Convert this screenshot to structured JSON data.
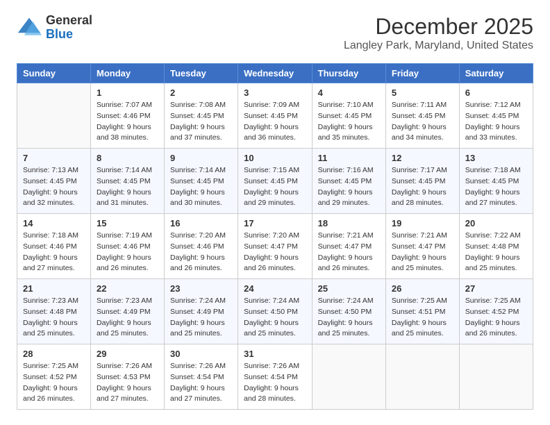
{
  "header": {
    "logo_general": "General",
    "logo_blue": "Blue",
    "month_title": "December 2025",
    "location": "Langley Park, Maryland, United States"
  },
  "weekdays": [
    "Sunday",
    "Monday",
    "Tuesday",
    "Wednesday",
    "Thursday",
    "Friday",
    "Saturday"
  ],
  "weeks": [
    [
      {
        "day": "",
        "sunrise": "",
        "sunset": "",
        "daylight": ""
      },
      {
        "day": "1",
        "sunrise": "Sunrise: 7:07 AM",
        "sunset": "Sunset: 4:46 PM",
        "daylight": "Daylight: 9 hours and 38 minutes."
      },
      {
        "day": "2",
        "sunrise": "Sunrise: 7:08 AM",
        "sunset": "Sunset: 4:45 PM",
        "daylight": "Daylight: 9 hours and 37 minutes."
      },
      {
        "day": "3",
        "sunrise": "Sunrise: 7:09 AM",
        "sunset": "Sunset: 4:45 PM",
        "daylight": "Daylight: 9 hours and 36 minutes."
      },
      {
        "day": "4",
        "sunrise": "Sunrise: 7:10 AM",
        "sunset": "Sunset: 4:45 PM",
        "daylight": "Daylight: 9 hours and 35 minutes."
      },
      {
        "day": "5",
        "sunrise": "Sunrise: 7:11 AM",
        "sunset": "Sunset: 4:45 PM",
        "daylight": "Daylight: 9 hours and 34 minutes."
      },
      {
        "day": "6",
        "sunrise": "Sunrise: 7:12 AM",
        "sunset": "Sunset: 4:45 PM",
        "daylight": "Daylight: 9 hours and 33 minutes."
      }
    ],
    [
      {
        "day": "7",
        "sunrise": "Sunrise: 7:13 AM",
        "sunset": "Sunset: 4:45 PM",
        "daylight": "Daylight: 9 hours and 32 minutes."
      },
      {
        "day": "8",
        "sunrise": "Sunrise: 7:14 AM",
        "sunset": "Sunset: 4:45 PM",
        "daylight": "Daylight: 9 hours and 31 minutes."
      },
      {
        "day": "9",
        "sunrise": "Sunrise: 7:14 AM",
        "sunset": "Sunset: 4:45 PM",
        "daylight": "Daylight: 9 hours and 30 minutes."
      },
      {
        "day": "10",
        "sunrise": "Sunrise: 7:15 AM",
        "sunset": "Sunset: 4:45 PM",
        "daylight": "Daylight: 9 hours and 29 minutes."
      },
      {
        "day": "11",
        "sunrise": "Sunrise: 7:16 AM",
        "sunset": "Sunset: 4:45 PM",
        "daylight": "Daylight: 9 hours and 29 minutes."
      },
      {
        "day": "12",
        "sunrise": "Sunrise: 7:17 AM",
        "sunset": "Sunset: 4:45 PM",
        "daylight": "Daylight: 9 hours and 28 minutes."
      },
      {
        "day": "13",
        "sunrise": "Sunrise: 7:18 AM",
        "sunset": "Sunset: 4:45 PM",
        "daylight": "Daylight: 9 hours and 27 minutes."
      }
    ],
    [
      {
        "day": "14",
        "sunrise": "Sunrise: 7:18 AM",
        "sunset": "Sunset: 4:46 PM",
        "daylight": "Daylight: 9 hours and 27 minutes."
      },
      {
        "day": "15",
        "sunrise": "Sunrise: 7:19 AM",
        "sunset": "Sunset: 4:46 PM",
        "daylight": "Daylight: 9 hours and 26 minutes."
      },
      {
        "day": "16",
        "sunrise": "Sunrise: 7:20 AM",
        "sunset": "Sunset: 4:46 PM",
        "daylight": "Daylight: 9 hours and 26 minutes."
      },
      {
        "day": "17",
        "sunrise": "Sunrise: 7:20 AM",
        "sunset": "Sunset: 4:47 PM",
        "daylight": "Daylight: 9 hours and 26 minutes."
      },
      {
        "day": "18",
        "sunrise": "Sunrise: 7:21 AM",
        "sunset": "Sunset: 4:47 PM",
        "daylight": "Daylight: 9 hours and 26 minutes."
      },
      {
        "day": "19",
        "sunrise": "Sunrise: 7:21 AM",
        "sunset": "Sunset: 4:47 PM",
        "daylight": "Daylight: 9 hours and 25 minutes."
      },
      {
        "day": "20",
        "sunrise": "Sunrise: 7:22 AM",
        "sunset": "Sunset: 4:48 PM",
        "daylight": "Daylight: 9 hours and 25 minutes."
      }
    ],
    [
      {
        "day": "21",
        "sunrise": "Sunrise: 7:23 AM",
        "sunset": "Sunset: 4:48 PM",
        "daylight": "Daylight: 9 hours and 25 minutes."
      },
      {
        "day": "22",
        "sunrise": "Sunrise: 7:23 AM",
        "sunset": "Sunset: 4:49 PM",
        "daylight": "Daylight: 9 hours and 25 minutes."
      },
      {
        "day": "23",
        "sunrise": "Sunrise: 7:24 AM",
        "sunset": "Sunset: 4:49 PM",
        "daylight": "Daylight: 9 hours and 25 minutes."
      },
      {
        "day": "24",
        "sunrise": "Sunrise: 7:24 AM",
        "sunset": "Sunset: 4:50 PM",
        "daylight": "Daylight: 9 hours and 25 minutes."
      },
      {
        "day": "25",
        "sunrise": "Sunrise: 7:24 AM",
        "sunset": "Sunset: 4:50 PM",
        "daylight": "Daylight: 9 hours and 25 minutes."
      },
      {
        "day": "26",
        "sunrise": "Sunrise: 7:25 AM",
        "sunset": "Sunset: 4:51 PM",
        "daylight": "Daylight: 9 hours and 25 minutes."
      },
      {
        "day": "27",
        "sunrise": "Sunrise: 7:25 AM",
        "sunset": "Sunset: 4:52 PM",
        "daylight": "Daylight: 9 hours and 26 minutes."
      }
    ],
    [
      {
        "day": "28",
        "sunrise": "Sunrise: 7:25 AM",
        "sunset": "Sunset: 4:52 PM",
        "daylight": "Daylight: 9 hours and 26 minutes."
      },
      {
        "day": "29",
        "sunrise": "Sunrise: 7:26 AM",
        "sunset": "Sunset: 4:53 PM",
        "daylight": "Daylight: 9 hours and 27 minutes."
      },
      {
        "day": "30",
        "sunrise": "Sunrise: 7:26 AM",
        "sunset": "Sunset: 4:54 PM",
        "daylight": "Daylight: 9 hours and 27 minutes."
      },
      {
        "day": "31",
        "sunrise": "Sunrise: 7:26 AM",
        "sunset": "Sunset: 4:54 PM",
        "daylight": "Daylight: 9 hours and 28 minutes."
      },
      {
        "day": "",
        "sunrise": "",
        "sunset": "",
        "daylight": ""
      },
      {
        "day": "",
        "sunrise": "",
        "sunset": "",
        "daylight": ""
      },
      {
        "day": "",
        "sunrise": "",
        "sunset": "",
        "daylight": ""
      }
    ]
  ]
}
